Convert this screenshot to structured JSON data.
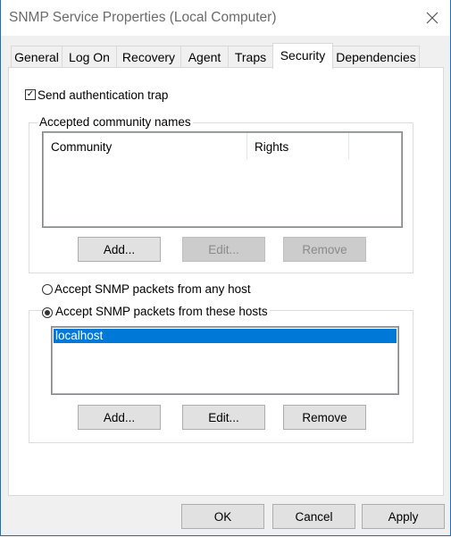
{
  "window": {
    "title": "SNMP Service Properties (Local Computer)"
  },
  "tabs": [
    {
      "label": "General"
    },
    {
      "label": "Log On"
    },
    {
      "label": "Recovery"
    },
    {
      "label": "Agent"
    },
    {
      "label": "Traps"
    },
    {
      "label": "Security",
      "active": true
    },
    {
      "label": "Dependencies"
    }
  ],
  "security": {
    "send_auth_trap": {
      "label": "Send authentication trap",
      "checked": true
    },
    "community_group": {
      "label": "Accepted community names",
      "columns": [
        "Community",
        "Rights"
      ],
      "rows": [],
      "buttons": {
        "add": "Add...",
        "edit": "Edit...",
        "remove": "Remove"
      }
    },
    "accept_any": {
      "label": "Accept SNMP packets from any host",
      "selected": false
    },
    "accept_these": {
      "label": "Accept SNMP packets from these hosts",
      "selected": true
    },
    "hosts": [
      "localhost"
    ],
    "hosts_buttons": {
      "add": "Add...",
      "edit": "Edit...",
      "remove": "Remove"
    }
  },
  "footer": {
    "ok": "OK",
    "cancel": "Cancel",
    "apply": "Apply"
  },
  "colors": {
    "selection": "#0078d7",
    "title_text": "#6b6b6b",
    "window_border": "#1f6fbf"
  }
}
